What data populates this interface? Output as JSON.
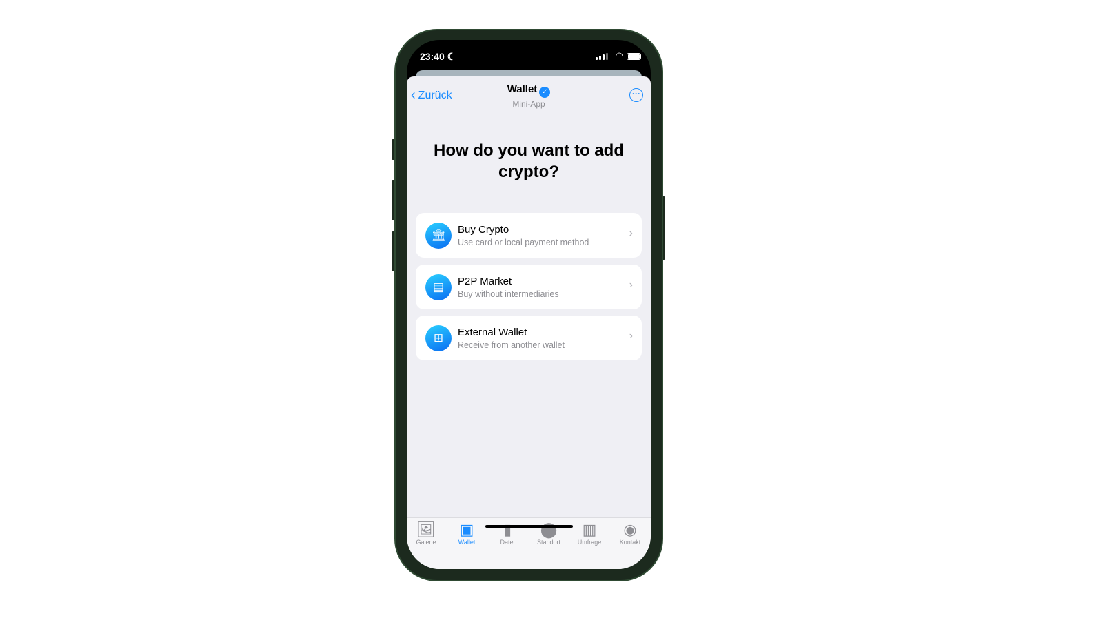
{
  "status": {
    "time": "23:40",
    "moon_icon": "moon-icon"
  },
  "nav": {
    "back_label": "Zurück",
    "title": "Wallet",
    "subtitle": "Mini-App",
    "verified_icon": "verified-badge-icon",
    "more_icon": "more-icon"
  },
  "heading": "How do you want to add crypto?",
  "options": [
    {
      "title": "Buy Crypto",
      "subtitle": "Use card or local payment method",
      "icon": "bank-icon"
    },
    {
      "title": "P2P Market",
      "subtitle": "Buy without intermediaries",
      "icon": "store-icon"
    },
    {
      "title": "External Wallet",
      "subtitle": "Receive from another wallet",
      "icon": "qr-code-icon"
    }
  ],
  "tabs": [
    {
      "label": "Galerie",
      "icon": "gallery-icon"
    },
    {
      "label": "Wallet",
      "icon": "wallet-icon",
      "active": true
    },
    {
      "label": "Datei",
      "icon": "file-icon"
    },
    {
      "label": "Standort",
      "icon": "location-icon"
    },
    {
      "label": "Umfrage",
      "icon": "poll-icon"
    },
    {
      "label": "Kontakt",
      "icon": "contact-icon"
    }
  ],
  "colors": {
    "accent": "#1a8cff",
    "background": "#efeff4"
  }
}
